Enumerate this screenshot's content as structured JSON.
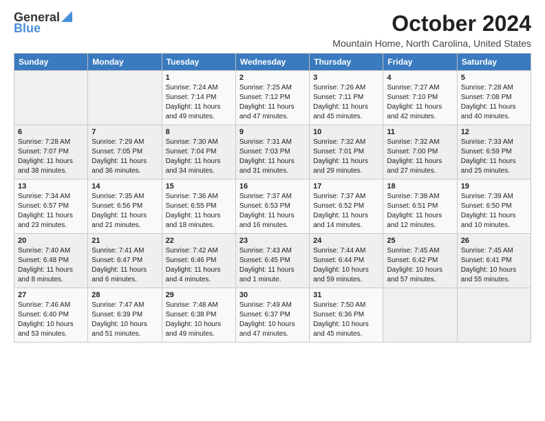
{
  "header": {
    "logo_general": "General",
    "logo_blue": "Blue",
    "month_title": "October 2024",
    "location": "Mountain Home, North Carolina, United States"
  },
  "weekdays": [
    "Sunday",
    "Monday",
    "Tuesday",
    "Wednesday",
    "Thursday",
    "Friday",
    "Saturday"
  ],
  "weeks": [
    [
      {
        "day": "",
        "info": ""
      },
      {
        "day": "",
        "info": ""
      },
      {
        "day": "1",
        "info": "Sunrise: 7:24 AM\nSunset: 7:14 PM\nDaylight: 11 hours and 49 minutes."
      },
      {
        "day": "2",
        "info": "Sunrise: 7:25 AM\nSunset: 7:12 PM\nDaylight: 11 hours and 47 minutes."
      },
      {
        "day": "3",
        "info": "Sunrise: 7:26 AM\nSunset: 7:11 PM\nDaylight: 11 hours and 45 minutes."
      },
      {
        "day": "4",
        "info": "Sunrise: 7:27 AM\nSunset: 7:10 PM\nDaylight: 11 hours and 42 minutes."
      },
      {
        "day": "5",
        "info": "Sunrise: 7:28 AM\nSunset: 7:08 PM\nDaylight: 11 hours and 40 minutes."
      }
    ],
    [
      {
        "day": "6",
        "info": "Sunrise: 7:28 AM\nSunset: 7:07 PM\nDaylight: 11 hours and 38 minutes."
      },
      {
        "day": "7",
        "info": "Sunrise: 7:29 AM\nSunset: 7:05 PM\nDaylight: 11 hours and 36 minutes."
      },
      {
        "day": "8",
        "info": "Sunrise: 7:30 AM\nSunset: 7:04 PM\nDaylight: 11 hours and 34 minutes."
      },
      {
        "day": "9",
        "info": "Sunrise: 7:31 AM\nSunset: 7:03 PM\nDaylight: 11 hours and 31 minutes."
      },
      {
        "day": "10",
        "info": "Sunrise: 7:32 AM\nSunset: 7:01 PM\nDaylight: 11 hours and 29 minutes."
      },
      {
        "day": "11",
        "info": "Sunrise: 7:32 AM\nSunset: 7:00 PM\nDaylight: 11 hours and 27 minutes."
      },
      {
        "day": "12",
        "info": "Sunrise: 7:33 AM\nSunset: 6:59 PM\nDaylight: 11 hours and 25 minutes."
      }
    ],
    [
      {
        "day": "13",
        "info": "Sunrise: 7:34 AM\nSunset: 6:57 PM\nDaylight: 11 hours and 23 minutes."
      },
      {
        "day": "14",
        "info": "Sunrise: 7:35 AM\nSunset: 6:56 PM\nDaylight: 11 hours and 21 minutes."
      },
      {
        "day": "15",
        "info": "Sunrise: 7:36 AM\nSunset: 6:55 PM\nDaylight: 11 hours and 18 minutes."
      },
      {
        "day": "16",
        "info": "Sunrise: 7:37 AM\nSunset: 6:53 PM\nDaylight: 11 hours and 16 minutes."
      },
      {
        "day": "17",
        "info": "Sunrise: 7:37 AM\nSunset: 6:52 PM\nDaylight: 11 hours and 14 minutes."
      },
      {
        "day": "18",
        "info": "Sunrise: 7:38 AM\nSunset: 6:51 PM\nDaylight: 11 hours and 12 minutes."
      },
      {
        "day": "19",
        "info": "Sunrise: 7:39 AM\nSunset: 6:50 PM\nDaylight: 11 hours and 10 minutes."
      }
    ],
    [
      {
        "day": "20",
        "info": "Sunrise: 7:40 AM\nSunset: 6:48 PM\nDaylight: 11 hours and 8 minutes."
      },
      {
        "day": "21",
        "info": "Sunrise: 7:41 AM\nSunset: 6:47 PM\nDaylight: 11 hours and 6 minutes."
      },
      {
        "day": "22",
        "info": "Sunrise: 7:42 AM\nSunset: 6:46 PM\nDaylight: 11 hours and 4 minutes."
      },
      {
        "day": "23",
        "info": "Sunrise: 7:43 AM\nSunset: 6:45 PM\nDaylight: 11 hours and 1 minute."
      },
      {
        "day": "24",
        "info": "Sunrise: 7:44 AM\nSunset: 6:44 PM\nDaylight: 10 hours and 59 minutes."
      },
      {
        "day": "25",
        "info": "Sunrise: 7:45 AM\nSunset: 6:42 PM\nDaylight: 10 hours and 57 minutes."
      },
      {
        "day": "26",
        "info": "Sunrise: 7:45 AM\nSunset: 6:41 PM\nDaylight: 10 hours and 55 minutes."
      }
    ],
    [
      {
        "day": "27",
        "info": "Sunrise: 7:46 AM\nSunset: 6:40 PM\nDaylight: 10 hours and 53 minutes."
      },
      {
        "day": "28",
        "info": "Sunrise: 7:47 AM\nSunset: 6:39 PM\nDaylight: 10 hours and 51 minutes."
      },
      {
        "day": "29",
        "info": "Sunrise: 7:48 AM\nSunset: 6:38 PM\nDaylight: 10 hours and 49 minutes."
      },
      {
        "day": "30",
        "info": "Sunrise: 7:49 AM\nSunset: 6:37 PM\nDaylight: 10 hours and 47 minutes."
      },
      {
        "day": "31",
        "info": "Sunrise: 7:50 AM\nSunset: 6:36 PM\nDaylight: 10 hours and 45 minutes."
      },
      {
        "day": "",
        "info": ""
      },
      {
        "day": "",
        "info": ""
      }
    ]
  ]
}
